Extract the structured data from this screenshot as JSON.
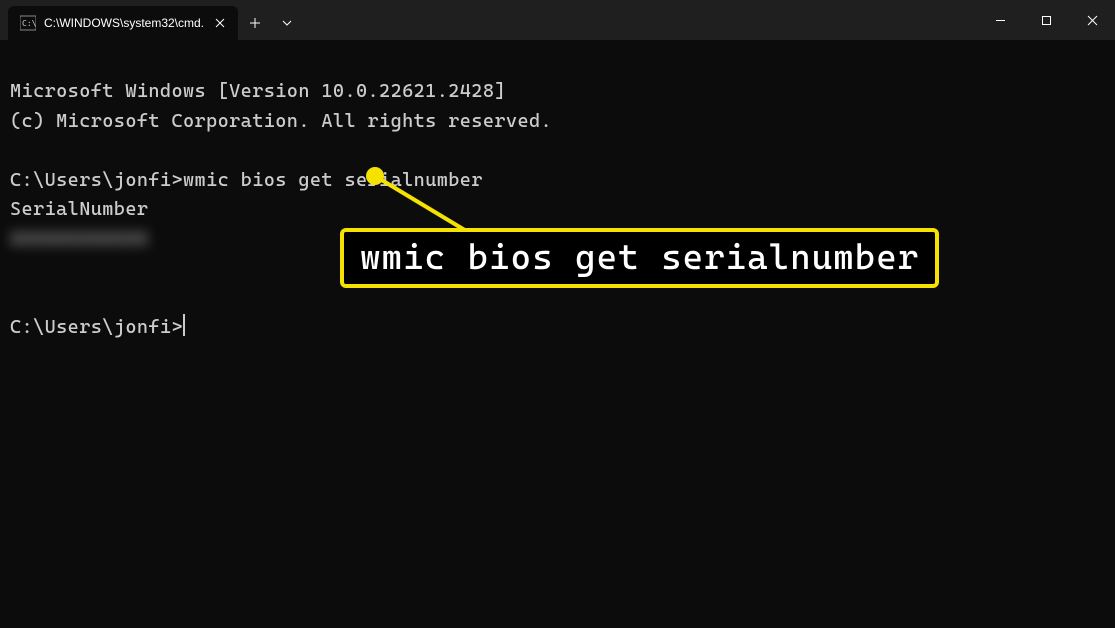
{
  "titlebar": {
    "tab_title": "C:\\WINDOWS\\system32\\cmd.",
    "tab_icon_name": "cmd-icon"
  },
  "terminal": {
    "line1": "Microsoft Windows [Version 10.0.22621.2428]",
    "line2": "(c) Microsoft Corporation. All rights reserved.",
    "prompt1": "C:\\Users\\jonfi>",
    "command1": "wmic bios get serialnumber",
    "output_header": "SerialNumber",
    "output_value_masked": "XXXXXXXXXXXX",
    "prompt2": "C:\\Users\\jonfi>"
  },
  "callout": {
    "text": "wmic bios get serialnumber",
    "color": "#f5e200"
  }
}
